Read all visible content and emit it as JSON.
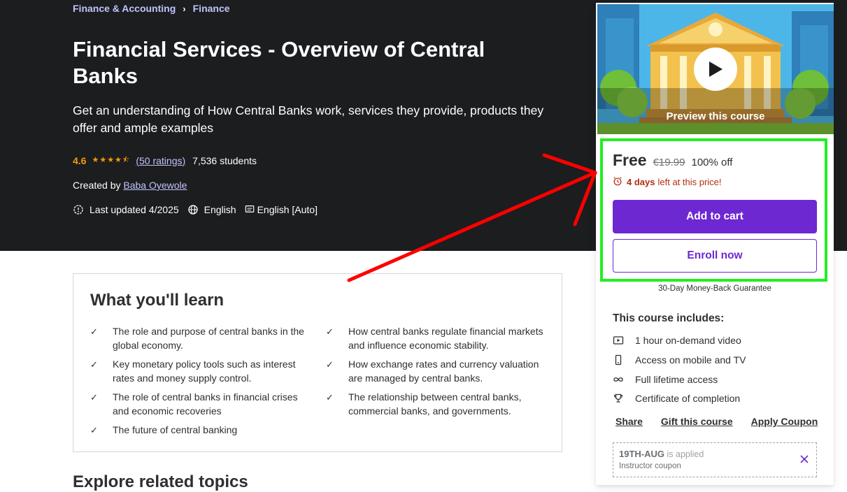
{
  "breadcrumb": {
    "items": [
      "Finance & Accounting",
      "Finance"
    ],
    "separator": "›"
  },
  "course": {
    "title": "Financial Services - Overview of Central Banks",
    "subtitle": "Get an understanding of How Central Banks work, services they provide, products they offer and ample examples",
    "rating": "4.6",
    "stars": "★★★★⯪",
    "ratings_count": "(50 ratings)",
    "students": "7,536 students",
    "created_by_label": "Created by",
    "instructor": "Baba Oyewole",
    "last_updated": "Last updated 4/2025",
    "language": "English",
    "captions": "English [Auto]"
  },
  "learn": {
    "heading": "What you'll learn",
    "items": [
      "The role and purpose of central banks in the global economy.",
      "How central banks regulate financial markets and influence economic stability.",
      "Key monetary policy tools such as interest rates and money supply control.",
      "How exchange rates and currency valuation are managed by central banks.",
      "The role of central banks in financial crises and economic recoveries",
      "The relationship between central banks, commercial banks, and governments.",
      "The future of central banking"
    ]
  },
  "related_heading": "Explore related topics",
  "sidebar": {
    "preview_label": "Preview this course",
    "price_current": "Free",
    "price_original": "€19.99",
    "discount": "100% off",
    "countdown_bold": "4 days",
    "countdown_rest": "left at this price!",
    "add_to_cart": "Add to cart",
    "enroll_now": "Enroll now",
    "guarantee": "30-Day Money-Back Guarantee",
    "includes_title": "This course includes:",
    "includes": [
      {
        "icon": "video-icon",
        "label": "1 hour on-demand video"
      },
      {
        "icon": "mobile-icon",
        "label": "Access on mobile and TV"
      },
      {
        "icon": "infinity-icon",
        "label": "Full lifetime access"
      },
      {
        "icon": "trophy-icon",
        "label": "Certificate of completion"
      }
    ],
    "links": {
      "share": "Share",
      "gift": "Gift this course",
      "coupon": "Apply Coupon"
    },
    "applied_coupon": {
      "code": "19TH-AUG",
      "status": "is applied",
      "type": "Instructor coupon"
    }
  },
  "colors": {
    "hero_bg": "#1c1d1f",
    "link_lavender": "#c0c4fc",
    "star_orange": "#f69c08",
    "brand_purple": "#6d28d2",
    "countdown_red": "#b32d0f",
    "highlight_green": "#22ee22",
    "annotation_red": "#ff0000"
  }
}
